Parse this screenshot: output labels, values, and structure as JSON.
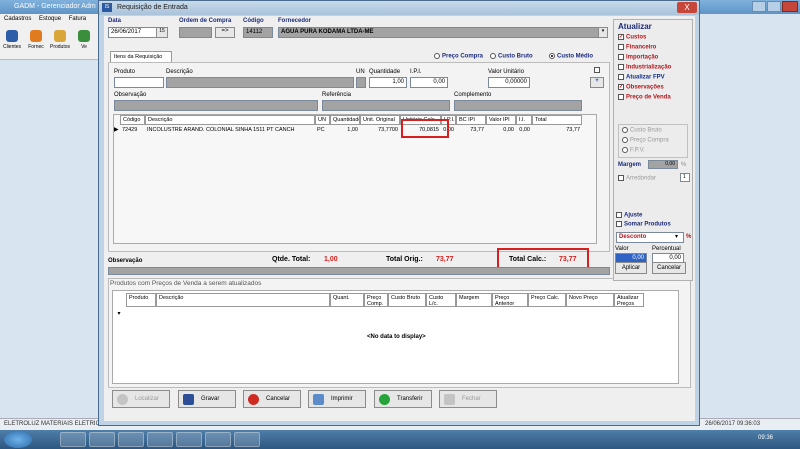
{
  "bg_app": {
    "title": "GADM - Gerenciador Adm",
    "menu": [
      "Cadastros",
      "Estoque",
      "Fatura"
    ],
    "toolbar": [
      "Clientes",
      "Fornec",
      "Produtos",
      "Ve"
    ],
    "status_left": "ELETROLUZ MATERIAIS ELETRICOS LTDA - MATRIZ IPIRANGA",
    "status_mid": "SUPERVISOR",
    "status_version": "Versão 3.2007.678.678",
    "status_datetime": "26/06/2017 09:36:03"
  },
  "window": {
    "title": "Requisição de Entrada",
    "close": "X"
  },
  "header": {
    "data_label": "Data",
    "data_value": "26/06/2017",
    "ordem_label": "Ordem de Compra",
    "ordem_value": "",
    "arrow": "=>",
    "codigo_label": "Código",
    "codigo_value": "14112",
    "fornecedor_label": "Fornecedor",
    "fornecedor_value": "AGUA PURA KODAMA LTDA-ME"
  },
  "tab_label": "Itens da Requisição",
  "price_options": [
    "Preço Compra",
    "Custo Bruto",
    "Custo Médio"
  ],
  "item_form": {
    "produto": "Produto",
    "descricao": "Descrição",
    "un": "UN",
    "quantidade": "Quantidade",
    "quantidade_value": "1,00",
    "ipi": "I.P.I.",
    "ipi_value": "0,00",
    "valor_unitario": "Valor Unitário",
    "valor_unitario_value": "0,00000",
    "plus": "+",
    "observacao": "Observação",
    "referencia": "Referência",
    "complemento": "Complemento"
  },
  "grid": {
    "headers": [
      "Código",
      "Descrição",
      "UN",
      "Quantidade",
      "Unit. Original",
      "Unitário Calc.",
      "I.P.I.",
      "BC IPI",
      "Valor IPI",
      "I.I.",
      "Total"
    ],
    "row": [
      "72429",
      "INCOLUSTRE ARAND. COLONIAL SINHA 1511 PT CANCH",
      "PC",
      "1,00",
      "73,7700",
      "70,0815",
      "0,00",
      "73,77",
      "0,00",
      "0,00",
      "73,77"
    ]
  },
  "totals": {
    "observacao": "Observação",
    "qtde_label": "Qtde. Total:",
    "qtde_value": "1,00",
    "orig_label": "Total Orig.:",
    "orig_value": "73,77",
    "calc_label": "Total Calc.:",
    "calc_value": "73,77"
  },
  "update_section": {
    "title": "Produtos com Preços de Venda a serem atualizados",
    "headers": [
      "Produto",
      "Descrição",
      "Quant.",
      "Preço Comp.",
      "Custo Bruto",
      "Custo L/c.",
      "Margem",
      "Preço Anterior",
      "Preço Calc.",
      "Novo Preço",
      "Atualizar Preços"
    ],
    "empty": "<No data to display>"
  },
  "sidebar": {
    "title": "Atualizar",
    "items": [
      {
        "label": "Custos",
        "checked": true
      },
      {
        "label": "Financeiro",
        "checked": false
      },
      {
        "label": "Importação",
        "checked": false
      },
      {
        "label": "Industrialização",
        "checked": false
      },
      {
        "label": "Atualizar FPV",
        "checked": false
      },
      {
        "label": "Observações",
        "checked": true
      },
      {
        "label": "Preço de Venda",
        "checked": false
      }
    ],
    "radios": [
      "Custo Bruto",
      "Preço Compra",
      "F.P.V."
    ],
    "margem_label": "Margem",
    "margem_value": "0,00",
    "margem_pct": "%",
    "arredondar": "Arredondar",
    "arredondar_value": "1",
    "ajuste": "Ajuste",
    "somar": "Somar Produtos",
    "desconto": "Desconto",
    "pct": "%",
    "valor_label": "Valor",
    "valor_value": "0,00",
    "percentual_label": "Percentual",
    "percentual_value": "0,00",
    "aplicar": "Aplicar",
    "cancelar": "Cancelar"
  },
  "bottom_buttons": [
    "Localizar",
    "Gravar",
    "Cancelar",
    "Imprimir",
    "Transferir",
    "Fechar"
  ],
  "taskbar": {
    "time": "09:36"
  }
}
